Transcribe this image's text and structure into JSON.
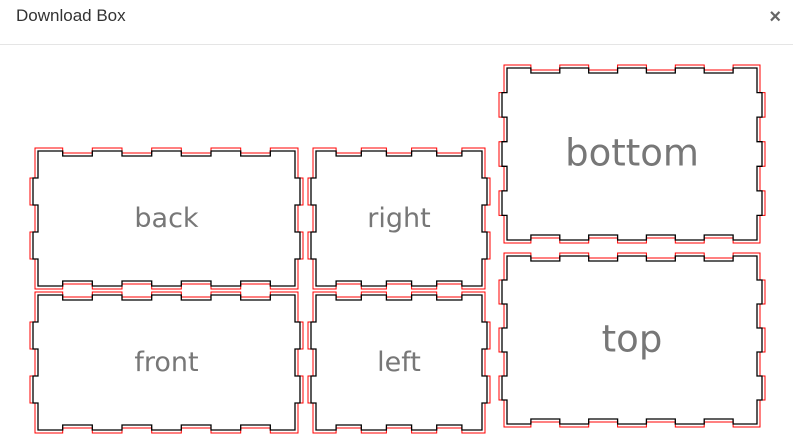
{
  "dialog": {
    "title": "Download Box",
    "close_icon": "close-icon"
  },
  "panels": [
    {
      "name": "back",
      "label": "back"
    },
    {
      "name": "right",
      "label": "right"
    },
    {
      "name": "front",
      "label": "front"
    },
    {
      "name": "left",
      "label": "left"
    },
    {
      "name": "bottom",
      "label": "bottom"
    },
    {
      "name": "top",
      "label": "top"
    }
  ],
  "colors": {
    "cut_line": "#000000",
    "kerf_line": "#ff0000",
    "label": "#777777"
  }
}
